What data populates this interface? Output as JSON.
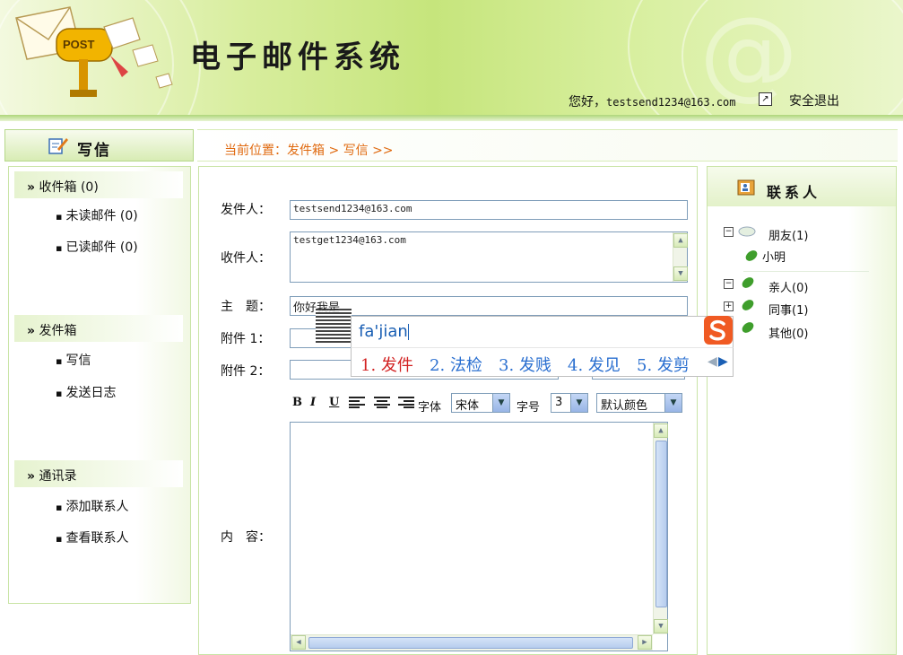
{
  "header": {
    "logo_text": "POST",
    "title": "电子邮件系统",
    "greeting_prefix": "您好，",
    "user_email": "testsend1234@163.com",
    "logout": "安全退出"
  },
  "left": {
    "title": "写信",
    "inbox": {
      "label": "收件箱",
      "count": "(0)",
      "items": [
        "未读邮件 (0)",
        "已读邮件 (0)"
      ]
    },
    "outbox": {
      "label": "发件箱",
      "items": [
        "写信",
        "发送日志"
      ]
    },
    "contacts": {
      "label": "通讯录",
      "items": [
        "添加联系人",
        "查看联系人"
      ]
    },
    "arrow": "»"
  },
  "breadcrumb": "当前位置：发件箱 > 写信 >>",
  "form": {
    "from_label": "发件人：",
    "from_value": "testsend1234@163.com",
    "to_label": "收件人：",
    "to_value": "testget1234@163.com",
    "subject_label": "主　题：",
    "subject_value": "你好我是",
    "attach1_label": "附件 1：",
    "attach2_label": "附件 2：",
    "content_label": "内　容：",
    "toolbar": {
      "bold": "B",
      "italic": "I",
      "underline": "U",
      "font_label": "字体",
      "font_value": "宋体",
      "size_label": "字号",
      "size_value": "3",
      "color_value": "默认颜色"
    }
  },
  "contacts_panel": {
    "title": "联系人",
    "groups": [
      {
        "name": "朋友",
        "count": "(1)",
        "expanded": true,
        "members": [
          "小明"
        ]
      },
      {
        "name": "亲人",
        "count": "(0)",
        "expanded": true,
        "members": []
      },
      {
        "name": "同事",
        "count": "(1)",
        "expanded": false,
        "members": []
      },
      {
        "name": "其他",
        "count": "(0)",
        "expanded": false,
        "members": []
      }
    ]
  },
  "ime": {
    "composition": "fa'jian",
    "candidates": [
      "1. 发件",
      "2. 法检",
      "3. 发贱",
      "4. 发见",
      "5. 发剪"
    ]
  },
  "colors": {
    "accent_green": "#c6e57c",
    "breadcrumb_orange": "#e06a10",
    "ime_blue": "#2a6fd0",
    "ime_first_red": "#d22222"
  }
}
